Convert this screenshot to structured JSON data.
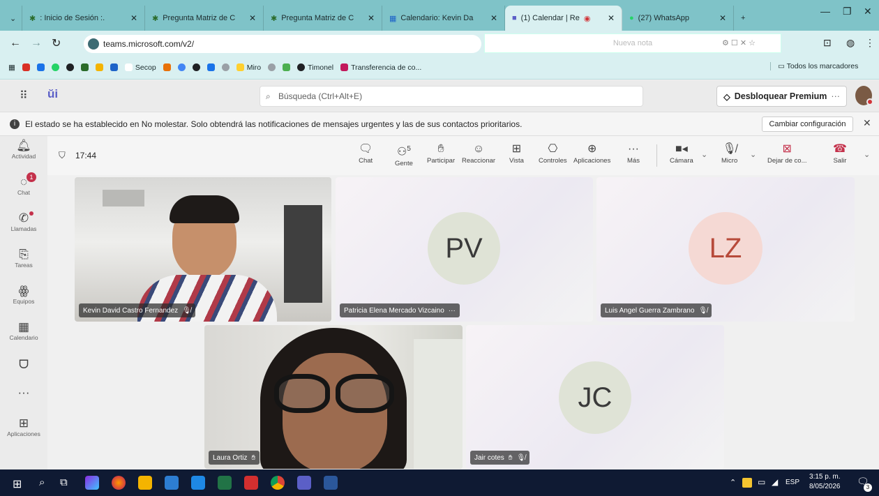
{
  "browser": {
    "tabs": [
      {
        "label": ": Inicio de Sesión :.",
        "active": false
      },
      {
        "label": "Pregunta Matriz de C",
        "active": false
      },
      {
        "label": "Pregunta Matriz de C",
        "active": false
      },
      {
        "label": "Calendario: Kevin Da",
        "active": false
      },
      {
        "label": "(1) Calendar | Re",
        "active": true
      },
      {
        "label": "(27) WhatsApp",
        "active": false
      }
    ],
    "url": "teams.microsoft.com/v2/",
    "note_placeholder": "Nueva nota",
    "bookmarks": [
      "Secop",
      "Miro",
      "Timonel",
      "Transferencia de co..."
    ],
    "all_bookmarks": "Todos los marcadores"
  },
  "teams": {
    "search_placeholder": "Búsqueda (Ctrl+Alt+E)",
    "premium_label": "Desbloquear Premium",
    "premium_more": "···",
    "notification": "El estado se ha establecido en No molestar. Solo obtendrá las notificaciones de mensajes urgentes y las de sus contactos prioritarios.",
    "change_config": "Cambiar configuración",
    "rail": [
      {
        "label": "Actividad",
        "icon": "bell-icon"
      },
      {
        "label": "Chat",
        "icon": "chat-icon",
        "badge": "1"
      },
      {
        "label": "Llamadas",
        "icon": "phone-icon"
      },
      {
        "label": "Tareas",
        "icon": "tasks-icon"
      },
      {
        "label": "Equipos",
        "icon": "teams-icon"
      },
      {
        "label": "Calendario",
        "icon": "calendar-icon"
      },
      {
        "label": "",
        "icon": "loop-icon"
      },
      {
        "label": "···",
        "icon": "more-icon"
      },
      {
        "label": "Aplicaciones",
        "icon": "apps-icon"
      }
    ],
    "meeting": {
      "timer": "17:44",
      "people_count": "5",
      "toolbar": [
        "Chat",
        "Gente",
        "Participar",
        "Reaccionar",
        "Vista",
        "Controles",
        "Aplicaciones",
        "Más",
        "Cámara",
        "Micro",
        "Dejar de co...",
        "Salir"
      ]
    },
    "participants": [
      {
        "name": "Kevin David Castro Fernandez",
        "initials": ""
      },
      {
        "name": "Patricia Elena Mercado Vizcaino",
        "initials": "PV",
        "extra": "···"
      },
      {
        "name": "Luis Angel Guerra Zambrano",
        "initials": "LZ"
      },
      {
        "name": "Laura Ortiz",
        "initials": ""
      },
      {
        "name": "Jair cotes",
        "initials": "JC"
      }
    ]
  },
  "taskbar": {
    "lang": "ESP",
    "time": "3:15 p. m.",
    "date": "8/05/2026",
    "notif_count": "3"
  },
  "colors": {
    "tabstrip": "#7fc3c8",
    "teams_purple": "#5b5fc7",
    "taskbar": "#0f1a33"
  }
}
